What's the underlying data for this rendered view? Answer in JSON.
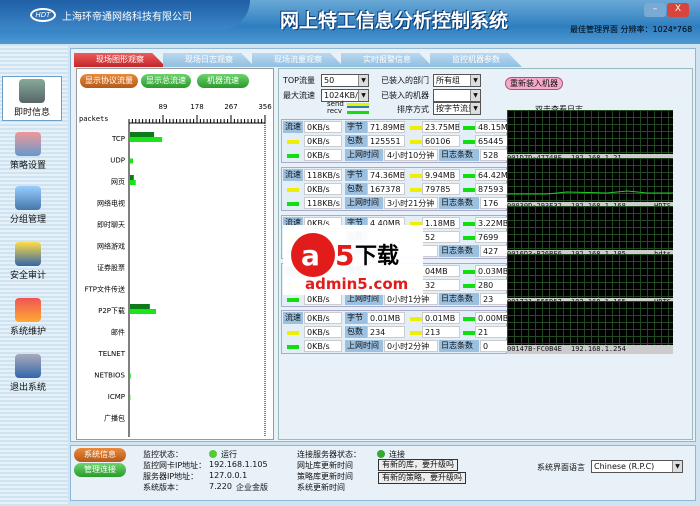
{
  "header": {
    "company": "上海环帝通网络科技有限公司",
    "logo_text": "HDT",
    "title": "网上特工信息分析控制系统",
    "resolution": "最佳管理界面 分辨率：1024*768",
    "minimize": "–",
    "close": "X"
  },
  "sidebar": {
    "items": [
      {
        "label": "即时信息",
        "active": true
      },
      {
        "label": "策略设置"
      },
      {
        "label": "分组管理"
      },
      {
        "label": "安全审计"
      },
      {
        "label": "系统维护"
      },
      {
        "label": "退出系统"
      }
    ]
  },
  "tabs": [
    {
      "label": "现场图形观察",
      "active": true
    },
    {
      "label": "现场日志观察"
    },
    {
      "label": "现场流量观察"
    },
    {
      "label": "实时报警信息"
    },
    {
      "label": "监控机器参数"
    }
  ],
  "chart_buttons": [
    "显示协议流量",
    "显示总流速",
    "机器流速"
  ],
  "chart_data": {
    "type": "bar",
    "orientation": "horizontal",
    "unit_label": "packets",
    "xlim": [
      0,
      356
    ],
    "ticks": [
      89,
      178,
      267,
      356
    ],
    "categories": [
      "TCP",
      "UDP",
      "网页",
      "网络电视",
      "即时聊天",
      "网络游戏",
      "证券股票",
      "FTP文件传送",
      "P2P下载",
      "邮件",
      "TELNET",
      "NETBIOS",
      "ICMP",
      "广播包"
    ],
    "series": [
      {
        "name": "send",
        "color": "#0f7a1a",
        "values": [
          63,
          0,
          10,
          0,
          0,
          0,
          0,
          0,
          52,
          0,
          0,
          0,
          0,
          0
        ]
      },
      {
        "name": "recv",
        "color": "#19e619",
        "values": [
          84,
          8,
          15,
          0,
          0,
          0,
          0,
          0,
          68,
          0,
          0,
          2,
          1,
          0
        ]
      }
    ]
  },
  "controls": {
    "top_label": "TOP流量",
    "top_value": "50",
    "max_label": "最大流速",
    "max_value": "1024KB/S",
    "dept_label": "已装入的部门",
    "dept_value": "所有组",
    "machine_label": "已装入的机器",
    "machine_value": "",
    "sort_label": "排序方式",
    "sort_value": "按字节流量",
    "reload": "重新装入机器",
    "send": "send",
    "recv": "recv",
    "hint": "双击查看日志"
  },
  "labels": {
    "speed": "流速",
    "bytes": "字节",
    "packets": "包数",
    "uptime": "上网时间",
    "logs": "日志条数"
  },
  "machines": [
    {
      "speed": "0KB/s",
      "send_speed": "0KB/s",
      "recv_speed": "0KB/s",
      "bytes": "71.89MB",
      "send_bytes": "23.75MB",
      "recv_bytes": "48.15MB",
      "packets": "125551",
      "send_packets": "60106",
      "recv_packets": "65445",
      "uptime": "4小时10分钟",
      "logs": "528",
      "mac": "001D7D-47748F",
      "ip": "192.168.1.21",
      "group": ""
    },
    {
      "speed": "118KB/s",
      "send_speed": "0KB/s",
      "recv_speed": "118KB/s",
      "bytes": "74.36MB",
      "send_bytes": "9.94MB",
      "recv_bytes": "64.42MB",
      "packets": "167378",
      "send_packets": "79785",
      "recv_packets": "87593",
      "uptime": "3小时21分钟",
      "logs": "176",
      "mac": "00030D-293F32",
      "ip": "192.168.1.168",
      "group": "HDTS"
    },
    {
      "speed": "0KB/s",
      "send_speed": "",
      "recv_speed": "",
      "bytes": "4.40MB",
      "send_bytes": "1.18MB",
      "recv_bytes": "3.22MB",
      "packets": "",
      "send_packets": "52",
      "recv_packets": "7699",
      "uptime": "",
      "logs": "427",
      "mac": "0016D3-B26BF6",
      "ip": "192.168.1.105",
      "group": "hdts"
    },
    {
      "speed": "",
      "send_speed": "",
      "recv_speed": "0KB/s",
      "bytes": "",
      "send_bytes": "04MB",
      "recv_bytes": "0.03MB",
      "packets": "",
      "send_packets": "32",
      "recv_packets": "280",
      "uptime": "0小时1分钟",
      "logs": "23",
      "mac": "001731-555D57",
      "ip": "192.168.1.165",
      "group": "HDTS"
    },
    {
      "speed": "0KB/s",
      "send_speed": "0KB/s",
      "recv_speed": "0KB/s",
      "bytes": "0.01MB",
      "send_bytes": "0.01MB",
      "recv_bytes": "0.00MB",
      "packets": "234",
      "send_packets": "213",
      "recv_packets": "21",
      "uptime": "0小时2分钟",
      "logs": "0",
      "mac": "00147B-FC0B4E",
      "ip": "192.168.1.254",
      "group": ""
    }
  ],
  "bottom": {
    "btn_info": "系统信息",
    "btn_conn": "管理连接",
    "monitor_label": "监控状态：",
    "monitor_value": "运行",
    "nic_label": "监控网卡IP地址：",
    "nic_value": "192.168.1.105",
    "server_label": "服务器IP地址：",
    "server_value": "127.0.0.1",
    "version_label": "系统版本：",
    "version_value": "7.220",
    "edition": "企业金版",
    "conn_label": "连接服务器状态：",
    "conn_value": "连接",
    "url_db": "网址库更新时间",
    "policy_db": "策略库更新时间",
    "sys_update": "系统更新时间",
    "upgrade_lib": "有新的库，要升级吗",
    "upgrade_policy": "有新的策略，要升级吗",
    "lang_label": "系统界面语言",
    "lang_value": "Chinese (R.P.C)"
  },
  "watermark": {
    "logo": "a5下载",
    "site": "admin5.com"
  }
}
